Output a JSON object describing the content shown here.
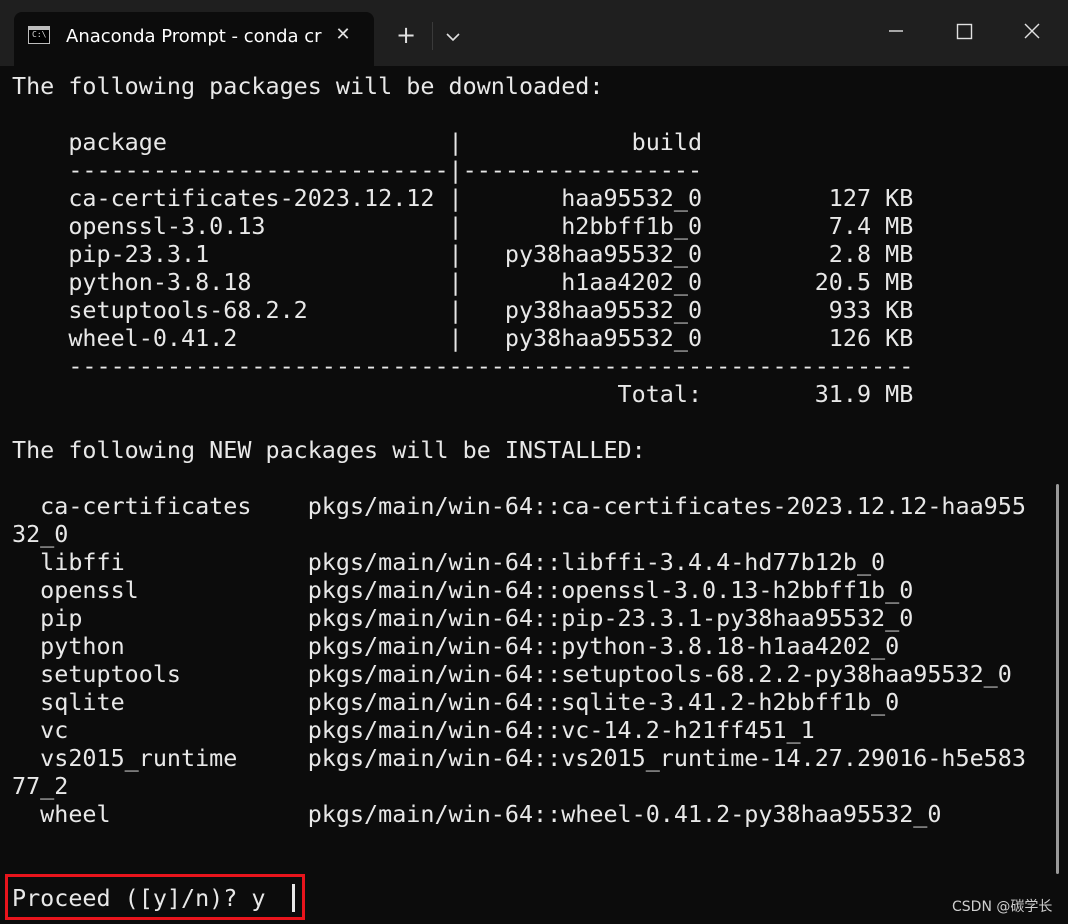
{
  "tab": {
    "icon_text": "C:\\",
    "title": "Anaconda Prompt - conda  cr",
    "close_symbol": "✕"
  },
  "titlebar": {
    "new_tab_symbol": "+"
  },
  "terminal": {
    "lines": [
      "The following packages will be downloaded:",
      "",
      "    package                    |            build",
      "    ---------------------------|-----------------",
      "    ca-certificates-2023.12.12 |       haa95532_0         127 KB",
      "    openssl-3.0.13             |       h2bbff1b_0         7.4 MB",
      "    pip-23.3.1                 |   py38haa95532_0         2.8 MB",
      "    python-3.8.18              |       h1aa4202_0        20.5 MB",
      "    setuptools-68.2.2          |   py38haa95532_0         933 KB",
      "    wheel-0.41.2               |   py38haa95532_0         126 KB",
      "    ------------------------------------------------------------",
      "                                           Total:        31.9 MB",
      "",
      "The following NEW packages will be INSTALLED:",
      "",
      "  ca-certificates    pkgs/main/win-64::ca-certificates-2023.12.12-haa955",
      "32_0",
      "  libffi             pkgs/main/win-64::libffi-3.4.4-hd77b12b_0",
      "  openssl            pkgs/main/win-64::openssl-3.0.13-h2bbff1b_0",
      "  pip                pkgs/main/win-64::pip-23.3.1-py38haa95532_0",
      "  python             pkgs/main/win-64::python-3.8.18-h1aa4202_0",
      "  setuptools         pkgs/main/win-64::setuptools-68.2.2-py38haa95532_0",
      "  sqlite             pkgs/main/win-64::sqlite-3.41.2-h2bbff1b_0",
      "  vc                 pkgs/main/win-64::vc-14.2-h21ff451_1",
      "  vs2015_runtime     pkgs/main/win-64::vs2015_runtime-14.27.29016-h5e583",
      "77_2",
      "  wheel              pkgs/main/win-64::wheel-0.41.2-py38haa95532_0",
      "",
      ""
    ],
    "prompt": "Proceed ([y]/n)? y"
  },
  "watermark": "CSDN @碳学长",
  "colors": {
    "background": "#0c0c0c",
    "titlebar": "#1f1f1f",
    "text": "#e8e8e8",
    "highlight_border": "#e8141c"
  }
}
